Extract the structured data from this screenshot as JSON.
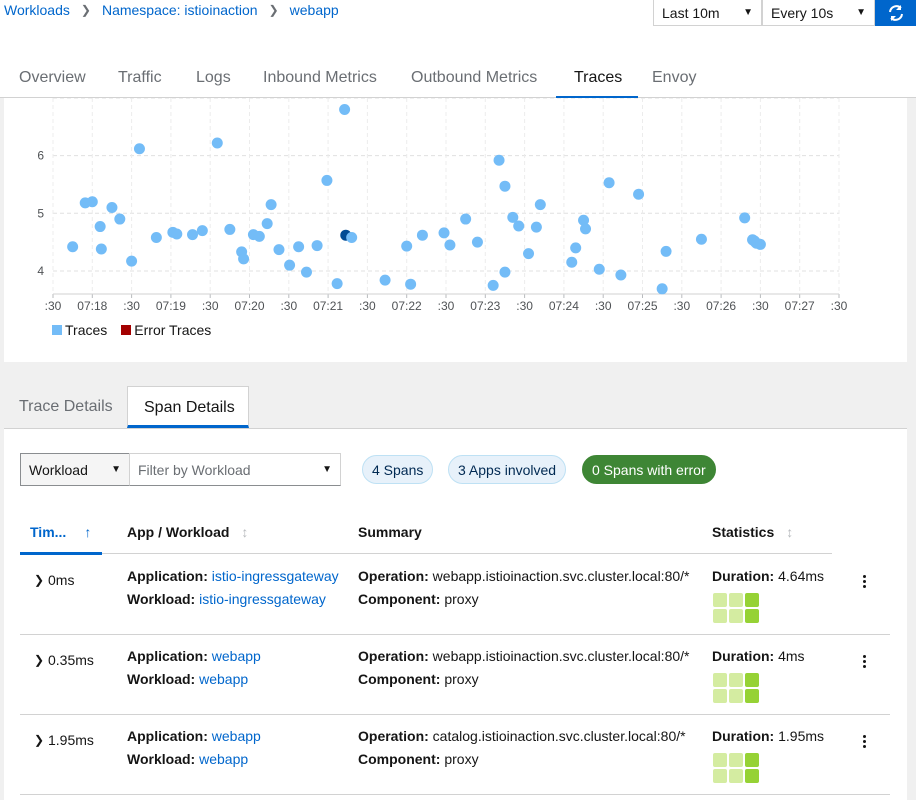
{
  "breadcrumb": {
    "items": [
      "Workloads",
      "Namespace: istioinaction",
      "webapp"
    ]
  },
  "toolbar": {
    "time_range": "Last 10m",
    "refresh_interval": "Every 10s"
  },
  "tabs": [
    "Overview",
    "Traffic",
    "Logs",
    "Inbound Metrics",
    "Outbound Metrics",
    "Traces",
    "Envoy"
  ],
  "active_tab": "Traces",
  "chart_data": {
    "type": "scatter",
    "y_ticks": [
      "4",
      "5",
      "6"
    ],
    "x_ticks": [
      ":30",
      "07:18",
      ":30",
      "07:19",
      ":30",
      "07:20",
      ":30",
      "07:21",
      ":30",
      "07:22",
      ":30",
      "07:23",
      ":30",
      "07:24",
      ":30",
      "07:25",
      ":30",
      "07:26",
      ":30",
      "07:27",
      ":30"
    ],
    "x_minutes": [
      0.5,
      0.82,
      1.0,
      1.23,
      1.2,
      1.5,
      1.7,
      2.0,
      2.2,
      2.63,
      3.05,
      3.15,
      3.55,
      3.8,
      4.18,
      4.5,
      4.8,
      4.85,
      5.1,
      5.25,
      5.45,
      5.55,
      5.75,
      6.02,
      6.25,
      6.45,
      6.72,
      6.97,
      7.23,
      7.42,
      7.45,
      7.6,
      8.45,
      9.0,
      9.1,
      9.4,
      9.95,
      10.1,
      10.5,
      10.8,
      11.2,
      11.35,
      11.5,
      11.5,
      11.7,
      11.85,
      12.1,
      12.3,
      12.4,
      13.2,
      13.3,
      13.5,
      13.55,
      13.9,
      14.15,
      14.45,
      14.9,
      15.5,
      15.6,
      16.5,
      17.6,
      17.8,
      17.85,
      17.87,
      17.9,
      18.0
    ],
    "y_values": [
      4.42,
      5.18,
      5.2,
      4.38,
      4.77,
      5.1,
      4.9,
      4.17,
      6.12,
      4.58,
      4.67,
      4.64,
      4.63,
      4.7,
      6.22,
      4.72,
      4.33,
      4.21,
      4.63,
      4.6,
      4.82,
      5.15,
      4.37,
      4.1,
      4.42,
      3.98,
      4.44,
      5.57,
      3.78,
      6.8,
      4.62,
      4.58,
      3.84,
      4.43,
      3.77,
      4.62,
      4.66,
      4.45,
      4.9,
      4.5,
      3.75,
      5.92,
      3.98,
      5.47,
      4.93,
      4.78,
      4.3,
      4.76,
      5.15,
      4.15,
      4.4,
      4.88,
      4.73,
      4.03,
      5.53,
      3.93,
      5.33,
      3.69,
      4.34,
      4.55,
      4.92,
      4.54,
      4.52,
      4.5,
      4.48,
      4.46
    ],
    "highlight_index": 30,
    "point_color": "#73bcf7",
    "highlight_color": "#004b95",
    "legend": [
      {
        "label": "Traces",
        "color": "#73bcf7"
      },
      {
        "label": "Error Traces",
        "color": "#a30000"
      }
    ]
  },
  "section_tabs": [
    "Trace Details",
    "Span Details"
  ],
  "filters": {
    "type": "Workload",
    "placeholder": "Filter by Workload"
  },
  "pills": {
    "spans": "4 Spans",
    "apps": "3 Apps involved",
    "errors": "0 Spans with error"
  },
  "table": {
    "headers": {
      "time": "Tim...",
      "app": "App / Workload",
      "summary": "Summary",
      "stats": "Statistics"
    },
    "labels": {
      "application": "Application:",
      "workload": "Workload:",
      "operation": "Operation:",
      "component": "Component:",
      "duration": "Duration:"
    },
    "rows": [
      {
        "time": "0ms",
        "application": "istio-ingressgateway",
        "workload": "istio-ingressgateway",
        "operation": "webapp.istioinaction.svc.cluster.local:80/*",
        "component": "proxy",
        "duration": "4.64ms"
      },
      {
        "time": "0.35ms",
        "application": "webapp",
        "workload": "webapp",
        "operation": "webapp.istioinaction.svc.cluster.local:80/*",
        "component": "proxy",
        "duration": "4ms"
      },
      {
        "time": "1.95ms",
        "application": "webapp",
        "workload": "webapp",
        "operation": "catalog.istioinaction.svc.cluster.local:80/*",
        "component": "proxy",
        "duration": "1.95ms"
      }
    ]
  }
}
